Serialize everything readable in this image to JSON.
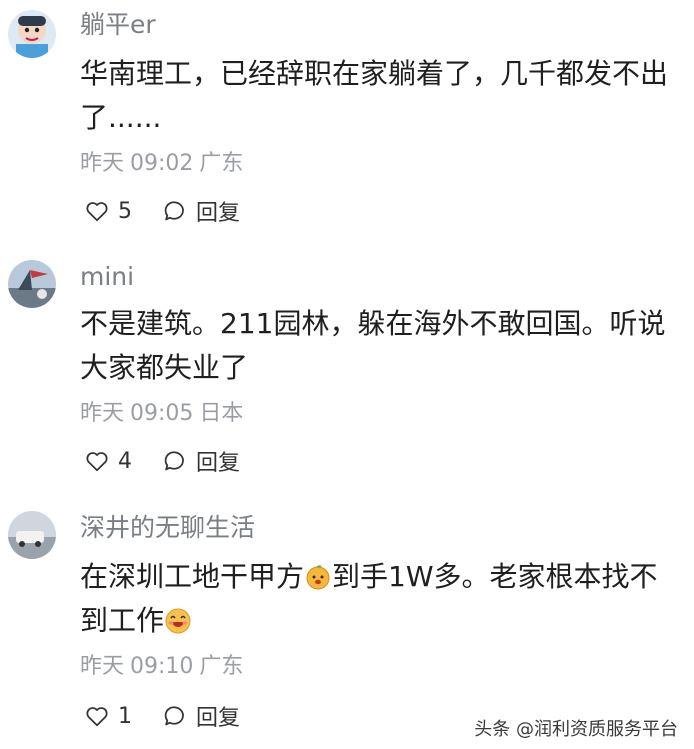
{
  "comments": [
    {
      "username": "躺平er",
      "text_line1": "华南理工，已经辞职在家躺着了，几千都发不出",
      "text_line2": "了......",
      "date": "昨天",
      "time": "09:02",
      "location": "广东",
      "likes": "5",
      "reply_label": "回复"
    },
    {
      "username": "mini",
      "text_line1": "不是建筑。211园林，躲在海外不敢回国。听说",
      "text_line2": "大家都失业了",
      "date": "昨天",
      "time": "09:05",
      "location": "日本",
      "likes": "4",
      "reply_label": "回复"
    },
    {
      "username": "深井的无聊生活",
      "text_line1_a": "在深圳工地干甲方",
      "text_line1_b": "到手1W多。老家根本找不",
      "text_line2": "到工作",
      "date": "昨天",
      "time": "09:10",
      "location": "广东",
      "likes": "1",
      "reply_label": "回复"
    }
  ],
  "icons": {
    "like": "heart-outline-icon",
    "reply": "speech-bubble-icon",
    "emoji1": "smiling-orange-emoji",
    "emoji2": "grinning-face-emoji"
  },
  "watermark": "头条 @润利资质服务平台",
  "colors": {
    "username": "#7a7f86",
    "meta": "#9a9ea4",
    "text": "#1f1f1f"
  }
}
